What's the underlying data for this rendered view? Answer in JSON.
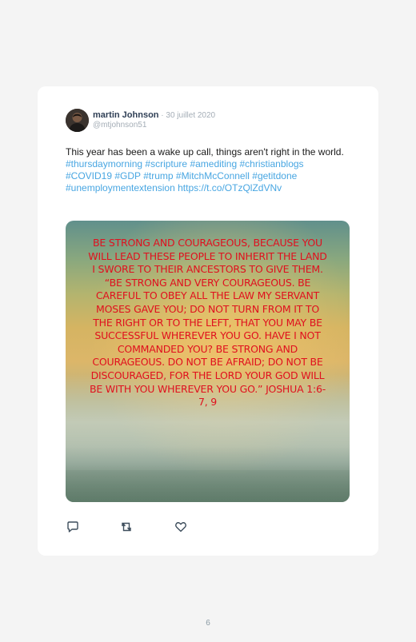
{
  "tweet": {
    "author_name": "martin Johnson",
    "separator": " · ",
    "date": "30 juillet 2020",
    "handle": "@mtjohnson51",
    "text": "This year has been a wake up call, things aren't right in the world. ",
    "hashtags": [
      "#thursdaymorning",
      "#scripture",
      "#amediting",
      "#christianblogs",
      "#COVID19",
      "#GDP",
      "#trump",
      "#MitchMcConnell",
      "#getitdone",
      "#unemploymentextension"
    ],
    "link": "https://t.co/OTzQlZdVNv",
    "image_text": "Be strong and courageous, because you will lead these people to inherit the land I swore to their ancestors to give them.  “Be strong and very courageous. Be careful to obey all the law my servant Moses gave you; do not turn from it to the right or to the left, that you may be successful wherever you go. Have I not commanded you? Be strong and courageous. Do not be afraid; do not be discouraged, for the Lord your God will be with you wherever you go.” Joshua 1:6-7, 9"
  },
  "actions": {
    "reply_icon": "reply-icon",
    "retweet_icon": "retweet-icon",
    "like_icon": "heart-icon"
  },
  "page": {
    "number": "6"
  },
  "colors": {
    "hashtag": "#48a6e2",
    "quote_text": "#e0101e",
    "name": "#2f3f55",
    "meta": "#a4adb6"
  }
}
